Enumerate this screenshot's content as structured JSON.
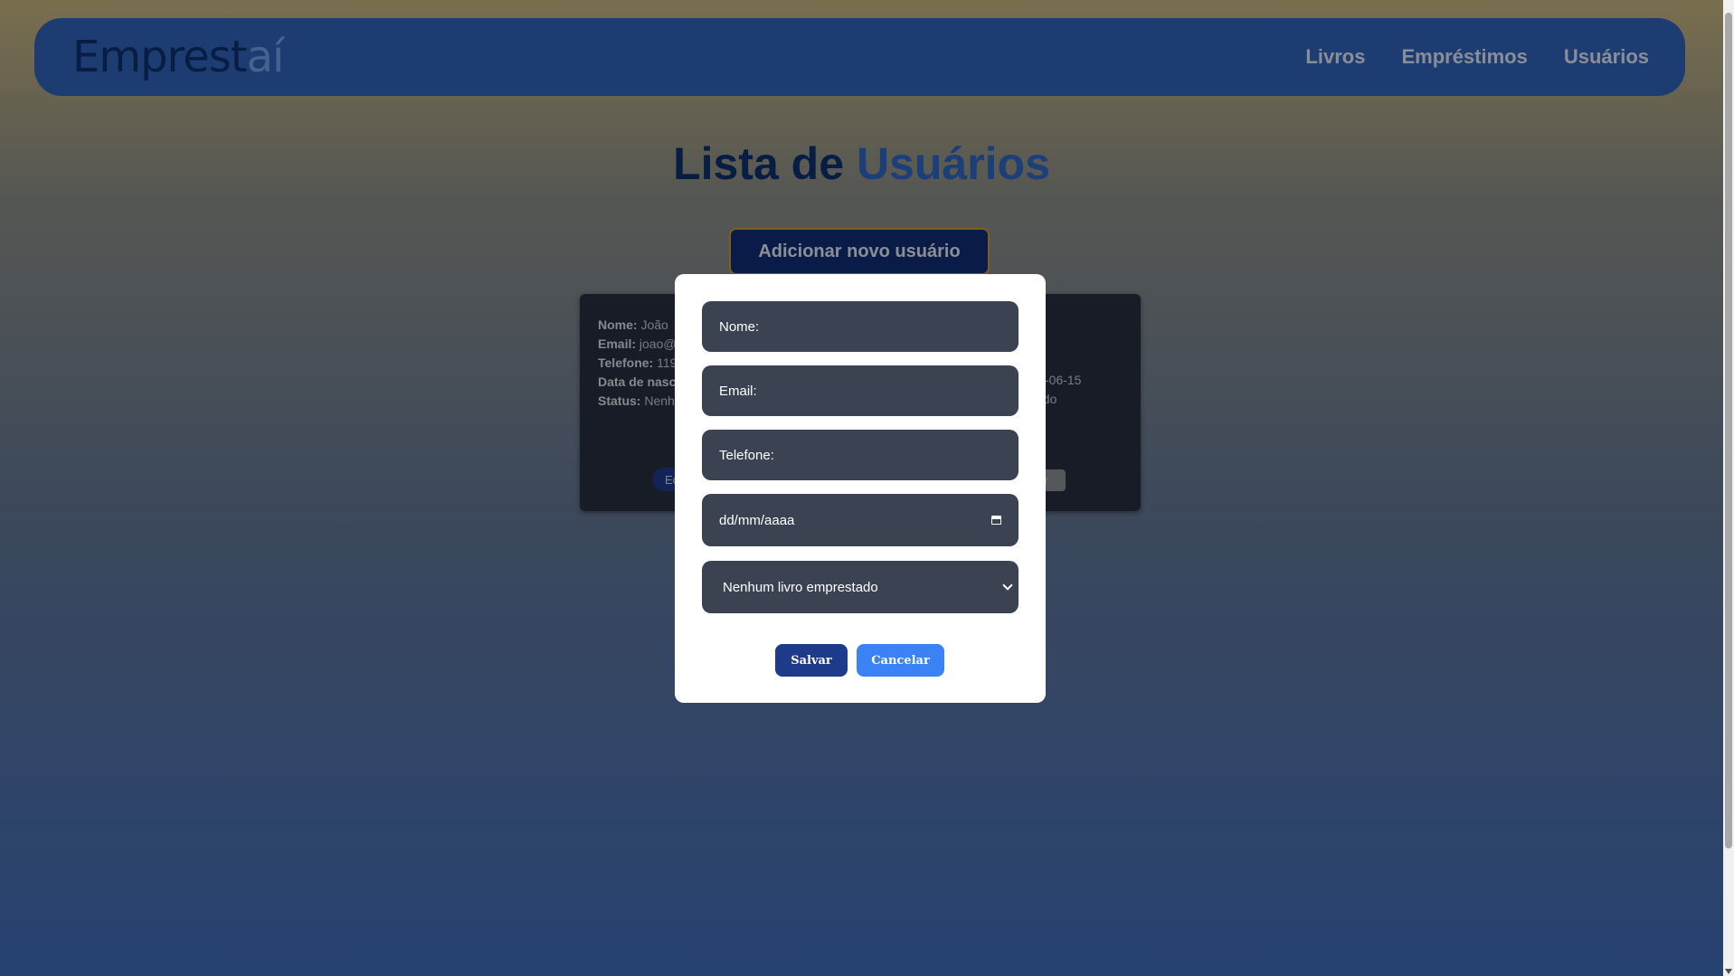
{
  "navbar": {
    "logo_part1": "Emprest",
    "logo_part2": "aí",
    "links": [
      "Livros",
      "Empréstimos",
      "Usuários"
    ]
  },
  "page": {
    "title_part1": "Lista de ",
    "title_part2": "Usuários",
    "add_button": "Adicionar novo usuário"
  },
  "user_card": {
    "nome_label": "Nome:",
    "nome_value": "João",
    "email_label": "Email:",
    "email_value": "joao@",
    "telefone_label": "Telefone:",
    "telefone_value": "119",
    "nasc_label": "Data de nasc",
    "status_label": "Status:",
    "status_value": "Nenh",
    "right_date_fragment": "-06-15",
    "right_status_fragment": "ado",
    "edit_fragment": "Ec",
    "delete_fragment": "r"
  },
  "modal": {
    "nome_placeholder": "Nome:",
    "email_placeholder": "Email:",
    "telefone_placeholder": "Telefone:",
    "date_placeholder": "dd/mm/aaaa",
    "select_value": "Nenhum livro emprestado",
    "save_label": "Salvar",
    "cancel_label": "Cancelar"
  },
  "colors": {
    "navbar": "#2f63b8",
    "primary_dark": "#1e3a8a",
    "accent_blue": "#3b82f6",
    "input_bg": "#3b4252",
    "card_bg": "#262e3e"
  }
}
